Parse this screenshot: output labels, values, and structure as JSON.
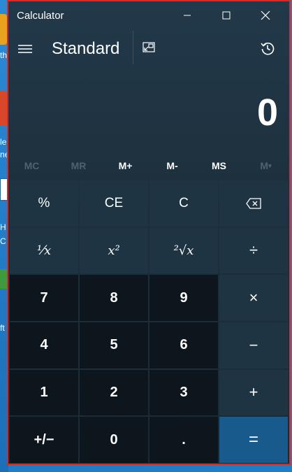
{
  "desktop": {
    "fragments": [
      "th",
      "le",
      "ne",
      "H",
      "C",
      "ft"
    ]
  },
  "window": {
    "title": "Calculator"
  },
  "header": {
    "mode": "Standard"
  },
  "display": {
    "value": "0"
  },
  "memory": [
    "MC",
    "MR",
    "M+",
    "M-",
    "MS",
    "M"
  ],
  "keys": {
    "percent": "%",
    "ce": "CE",
    "clear": "C",
    "reciprocal": "¹⁄𝑥",
    "square": "x²",
    "sqrt": "²√x",
    "divide": "÷",
    "seven": "7",
    "eight": "8",
    "nine": "9",
    "multiply": "×",
    "four": "4",
    "five": "5",
    "six": "6",
    "minus": "−",
    "one": "1",
    "two": "2",
    "three": "3",
    "plus": "+",
    "negate": "+/−",
    "zero": "0",
    "decimal": ".",
    "equals": "="
  },
  "colors": {
    "accent_equals": "#185a8c",
    "number_key": "#0e161d",
    "function_key": "#1f3442",
    "window_border": "#e5241f"
  }
}
